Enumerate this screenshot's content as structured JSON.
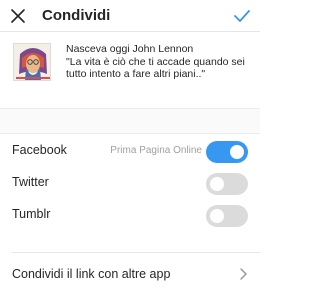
{
  "header": {
    "title": "Condividi",
    "close_icon": "close-icon",
    "confirm_icon": "checkmark-icon",
    "accent_color": "#3897f0"
  },
  "post": {
    "thumbnail_icon": "john-lennon-portrait-image",
    "caption": "Nasceva oggi John Lennon\n\"La vita è ciò che ti accade quando sei tutto intento a fare altri piani..\""
  },
  "share_targets": [
    {
      "label": "Facebook",
      "account": "Prima Pagina Online",
      "enabled": true
    },
    {
      "label": "Twitter",
      "account": "",
      "enabled": false
    },
    {
      "label": "Tumblr",
      "account": "",
      "enabled": false
    }
  ],
  "share_link": {
    "label": "Condividi il link con altre app",
    "icon": "chevron-right-icon"
  },
  "colors": {
    "toggle_on": "#3897f0",
    "toggle_off": "#dbdbdb"
  }
}
